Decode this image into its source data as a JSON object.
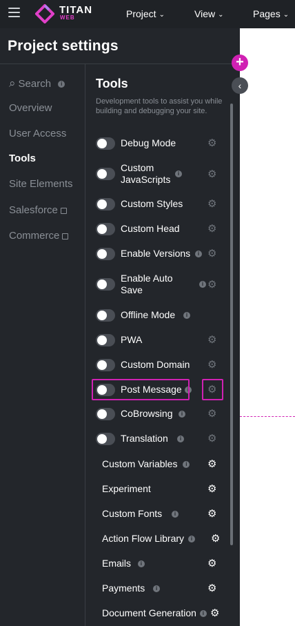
{
  "brand": {
    "name": "TITAN",
    "sub": "WEB"
  },
  "menu": [
    {
      "label": "Project"
    },
    {
      "label": "View"
    },
    {
      "label": "Pages"
    }
  ],
  "panel": {
    "title": "Project settings",
    "nav": [
      {
        "label": "Search"
      },
      {
        "label": "Overview"
      },
      {
        "label": "User Access"
      },
      {
        "label": "Tools"
      },
      {
        "label": "Site Elements"
      },
      {
        "label": "Salesforce"
      },
      {
        "label": "Commerce"
      }
    ]
  },
  "content": {
    "title": "Tools",
    "description": "Development tools to assist you while building and debugging your site.",
    "toggles": [
      {
        "label": "Debug Mode"
      },
      {
        "label": "Custom JavaScripts"
      },
      {
        "label": "Custom Styles"
      },
      {
        "label": "Custom Head"
      },
      {
        "label": "Enable Versions"
      },
      {
        "label": "Enable Auto Save"
      },
      {
        "label": "Offline Mode"
      },
      {
        "label": "PWA"
      },
      {
        "label": "Custom Domain"
      },
      {
        "label": "Post Message"
      },
      {
        "label": "CoBrowsing"
      },
      {
        "label": "Translation"
      }
    ],
    "settings": [
      {
        "label": "Custom Variables"
      },
      {
        "label": "Experiment"
      },
      {
        "label": "Custom Fonts"
      },
      {
        "label": "Action Flow Library"
      },
      {
        "label": "Emails"
      },
      {
        "label": "Payments"
      },
      {
        "label": "Document Generation"
      }
    ]
  },
  "icons": {
    "info": "i",
    "gear": "⚙",
    "add": "+",
    "collapse": "‹",
    "search": "⌕",
    "chevron": "⌄"
  },
  "colors": {
    "accent": "#d021b3",
    "panel": "#23262b",
    "topbar": "#1f2226"
  }
}
